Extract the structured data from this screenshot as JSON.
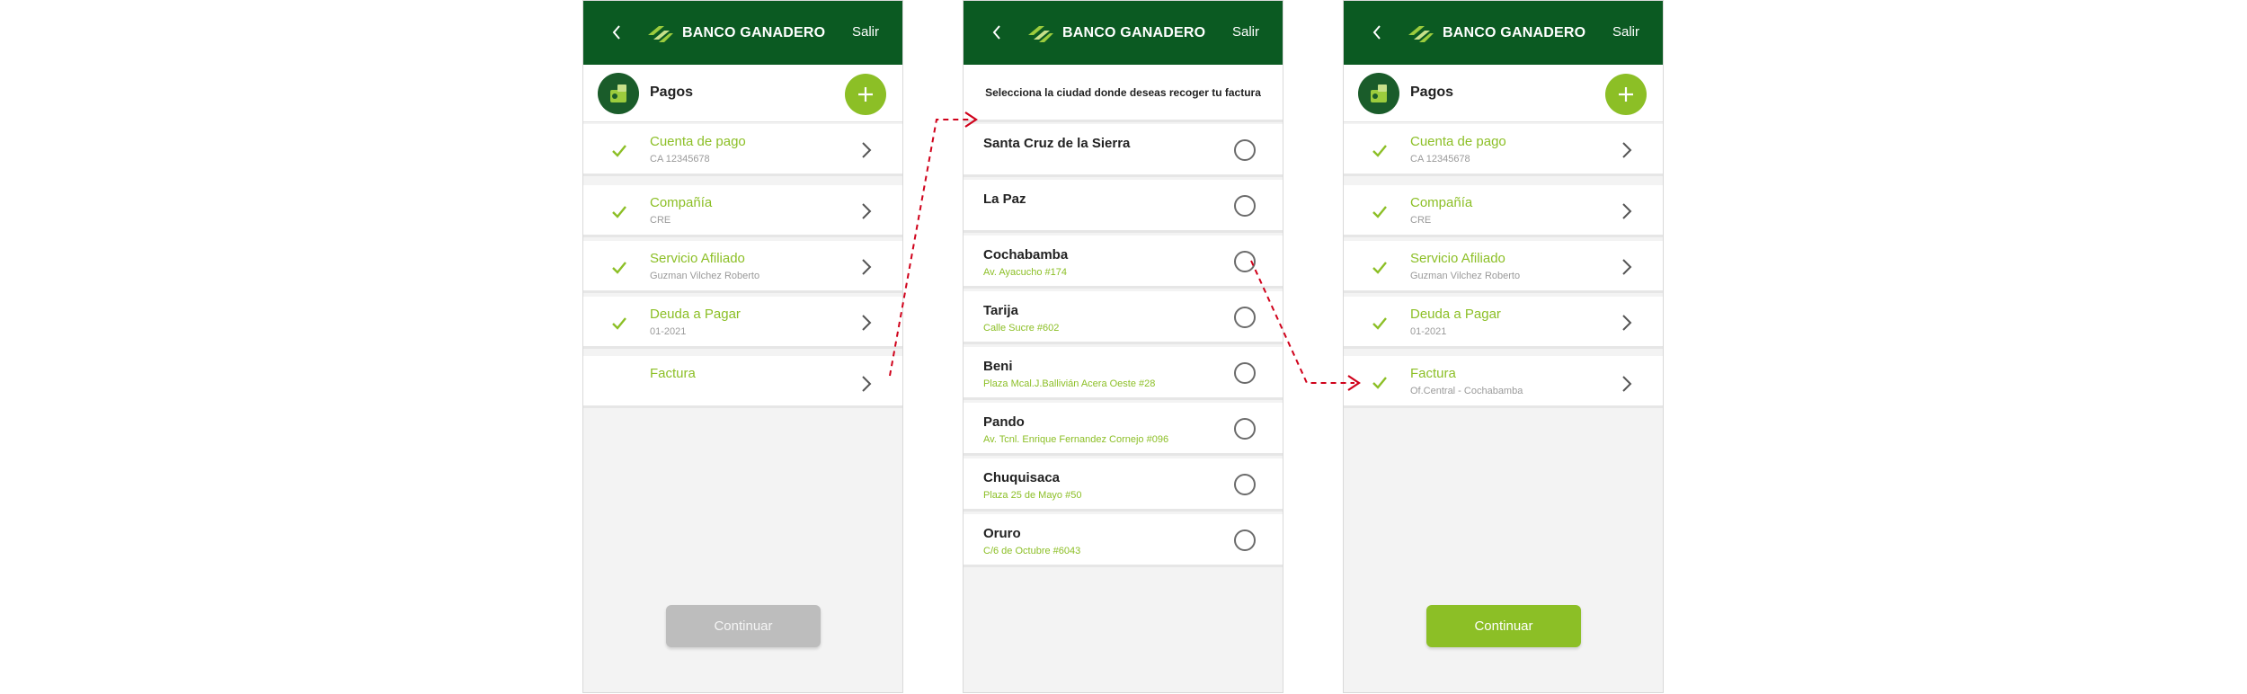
{
  "brand": {
    "name": "BANCO GANADERO",
    "primary_color": "#0b5a22",
    "accent_color": "#8cbf26"
  },
  "header": {
    "back_icon": "chevron-left-icon",
    "exit_label": "Salir"
  },
  "screen1": {
    "section_title": "Pagos",
    "rows": [
      {
        "title": "Cuenta de pago",
        "subtitle": "CA 12345678",
        "checked": true
      },
      {
        "title": "Compañía",
        "subtitle": "CRE",
        "checked": true
      },
      {
        "title": "Servicio Afiliado",
        "subtitle": "Guzman Vilchez Roberto",
        "checked": true
      },
      {
        "title": "Deuda a Pagar",
        "subtitle": "01-2021",
        "checked": true
      },
      {
        "title": "Factura",
        "subtitle": "",
        "checked": false
      }
    ],
    "continue_label": "Continuar",
    "continue_enabled": false
  },
  "screen2": {
    "instruction": "Selecciona la ciudad donde deseas recoger tu factura",
    "cities": [
      {
        "name": "Santa Cruz de la Sierra",
        "address": ""
      },
      {
        "name": "La Paz",
        "address": ""
      },
      {
        "name": "Cochabamba",
        "address": "Av. Ayacucho #174"
      },
      {
        "name": "Tarija",
        "address": "Calle Sucre #602"
      },
      {
        "name": "Beni",
        "address": "Plaza Mcal.J.Ballivián Acera Oeste #28"
      },
      {
        "name": "Pando",
        "address": "Av. Tcnl. Enrique Fernandez Cornejo #096"
      },
      {
        "name": "Chuquisaca",
        "address": "Plaza 25 de Mayo #50"
      },
      {
        "name": "Oruro",
        "address": "C/6 de Octubre #6043"
      }
    ]
  },
  "screen3": {
    "section_title": "Pagos",
    "rows": [
      {
        "title": "Cuenta de pago",
        "subtitle": "CA 12345678",
        "checked": true
      },
      {
        "title": "Compañía",
        "subtitle": "CRE",
        "checked": true
      },
      {
        "title": "Servicio Afiliado",
        "subtitle": "Guzman Vilchez Roberto",
        "checked": true
      },
      {
        "title": "Deuda a Pagar",
        "subtitle": "01-2021",
        "checked": true
      },
      {
        "title": "Factura",
        "subtitle": "Of.Central - Cochabamba",
        "checked": true
      }
    ],
    "continue_label": "Continuar",
    "continue_enabled": true
  },
  "flow_arrow_color": "#d0021b"
}
